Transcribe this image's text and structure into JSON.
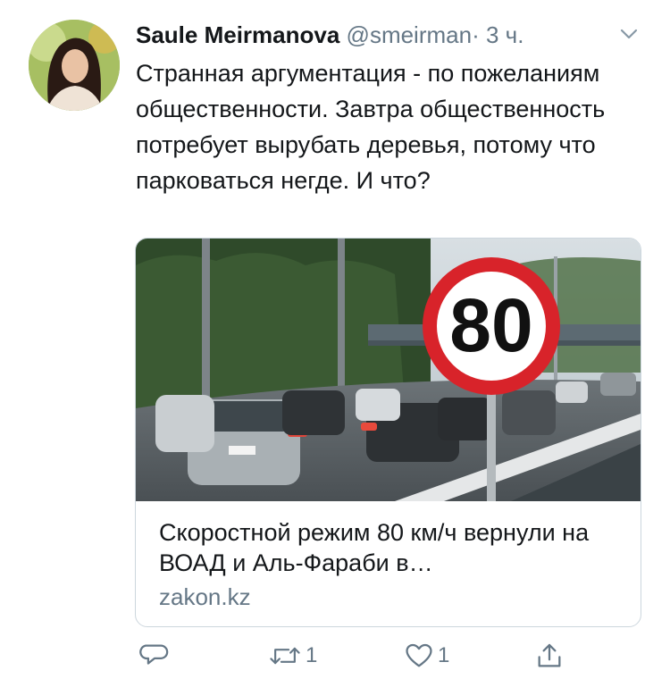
{
  "tweet": {
    "author_name": "Saule Meirmanova",
    "handle": "@smeirman",
    "separator": "·",
    "time": "3 ч.",
    "text": "Странная аргументация - по пожеланиям общественности. Завтра общественность потребует вырубать деревья, потому что парковаться негде. И что?"
  },
  "card": {
    "sign_text": "80",
    "title": "Скоростной режим 80 км/ч вернули на ВОАД и Аль-Фараби в…",
    "domain": "zakon.kz"
  },
  "actions": {
    "reply_icon": "reply-icon",
    "retweet_icon": "retweet-icon",
    "retweet_count": "1",
    "like_icon": "heart-icon",
    "like_count": "1",
    "share_icon": "share-icon"
  },
  "colors": {
    "text_primary": "#14171a",
    "text_secondary": "#657786",
    "card_border": "#ccd6dd",
    "sign_red": "#d8232a"
  }
}
